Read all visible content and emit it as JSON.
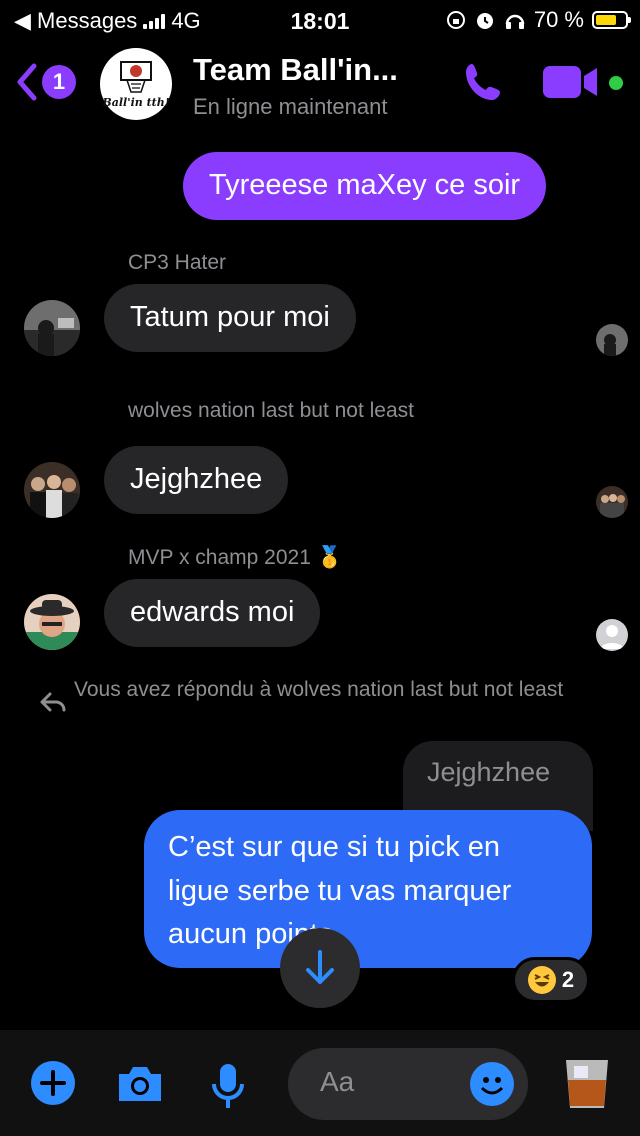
{
  "status_bar": {
    "carrier": "◀ Messages",
    "network": "4G",
    "time": "18:01",
    "battery": "70 %"
  },
  "header": {
    "unread_count": "1",
    "group_logo_text": "Ball'in tth!",
    "title": "Team Ball'in...",
    "subtitle": "En ligne maintenant"
  },
  "messages": {
    "m1": "Tyreeese maXey ce soir",
    "s2": "CP3 Hater",
    "m2": "Tatum pour moi",
    "s3": "wolves nation last but not least",
    "m3": "Jejghzhee",
    "s4": "MVP x champ 2021 🥇",
    "m4": "edwards moi",
    "reply_note": "Vous avez répondu à wolves nation last but not least",
    "quoted": "Jejghzhee",
    "m5": "C’est sur que si tu pick en ligue serbe tu vas marquer aucun points",
    "reaction_count": "2"
  },
  "composer": {
    "placeholder": "Aa"
  },
  "colors": {
    "accent_purple": "#8b3dff",
    "outgoing_blue": "#2d6af6",
    "incoming_gray": "#262628",
    "online_green": "#31cc46"
  }
}
